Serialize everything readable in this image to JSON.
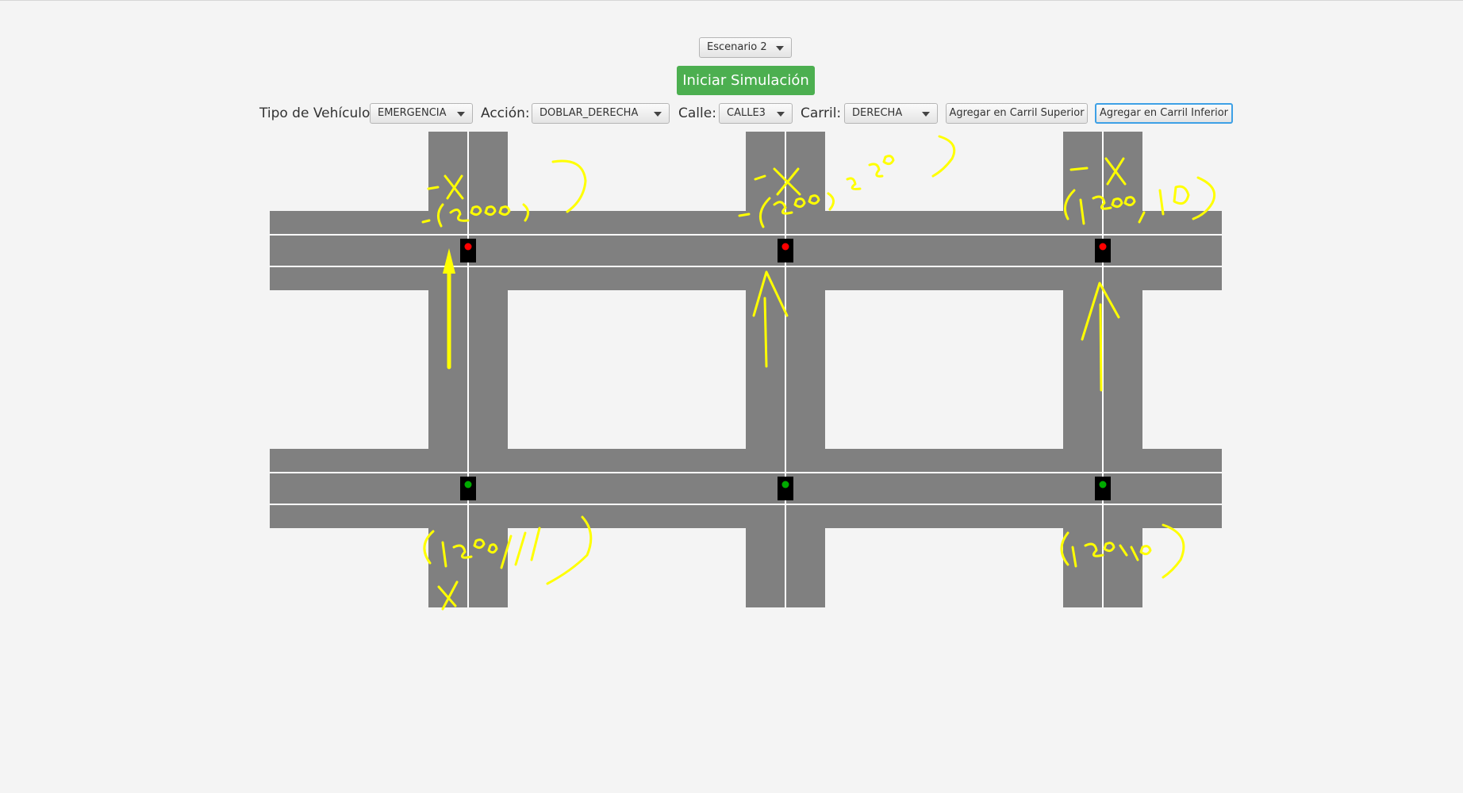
{
  "scenario_select": {
    "value": "Escenario 2"
  },
  "start_button": {
    "label": "Iniciar Simulación"
  },
  "controls": {
    "vehicle_type": {
      "label": "Tipo de Vehículo:",
      "value": "EMERGENCIA"
    },
    "action": {
      "label": "Acción:",
      "value": "DOBLAR_DERECHA"
    },
    "street": {
      "label": "Calle:",
      "value": "CALLE3"
    },
    "lane": {
      "label": "Carril:",
      "value": "DERECHA"
    },
    "add_upper_button": "Agregar en Carril Superior",
    "add_lower_button": "Agregar en Carril Inferior"
  },
  "traffic_lights": {
    "upper_row": [
      "red",
      "red",
      "red"
    ],
    "lower_row": [
      "green",
      "green",
      "green"
    ]
  },
  "colors": {
    "road": "#808080",
    "lane_line": "#ffffff",
    "light_red": "#ff0000",
    "light_green": "#00aa00",
    "annotation": "#ffff00",
    "start_button": "#4caf50"
  }
}
